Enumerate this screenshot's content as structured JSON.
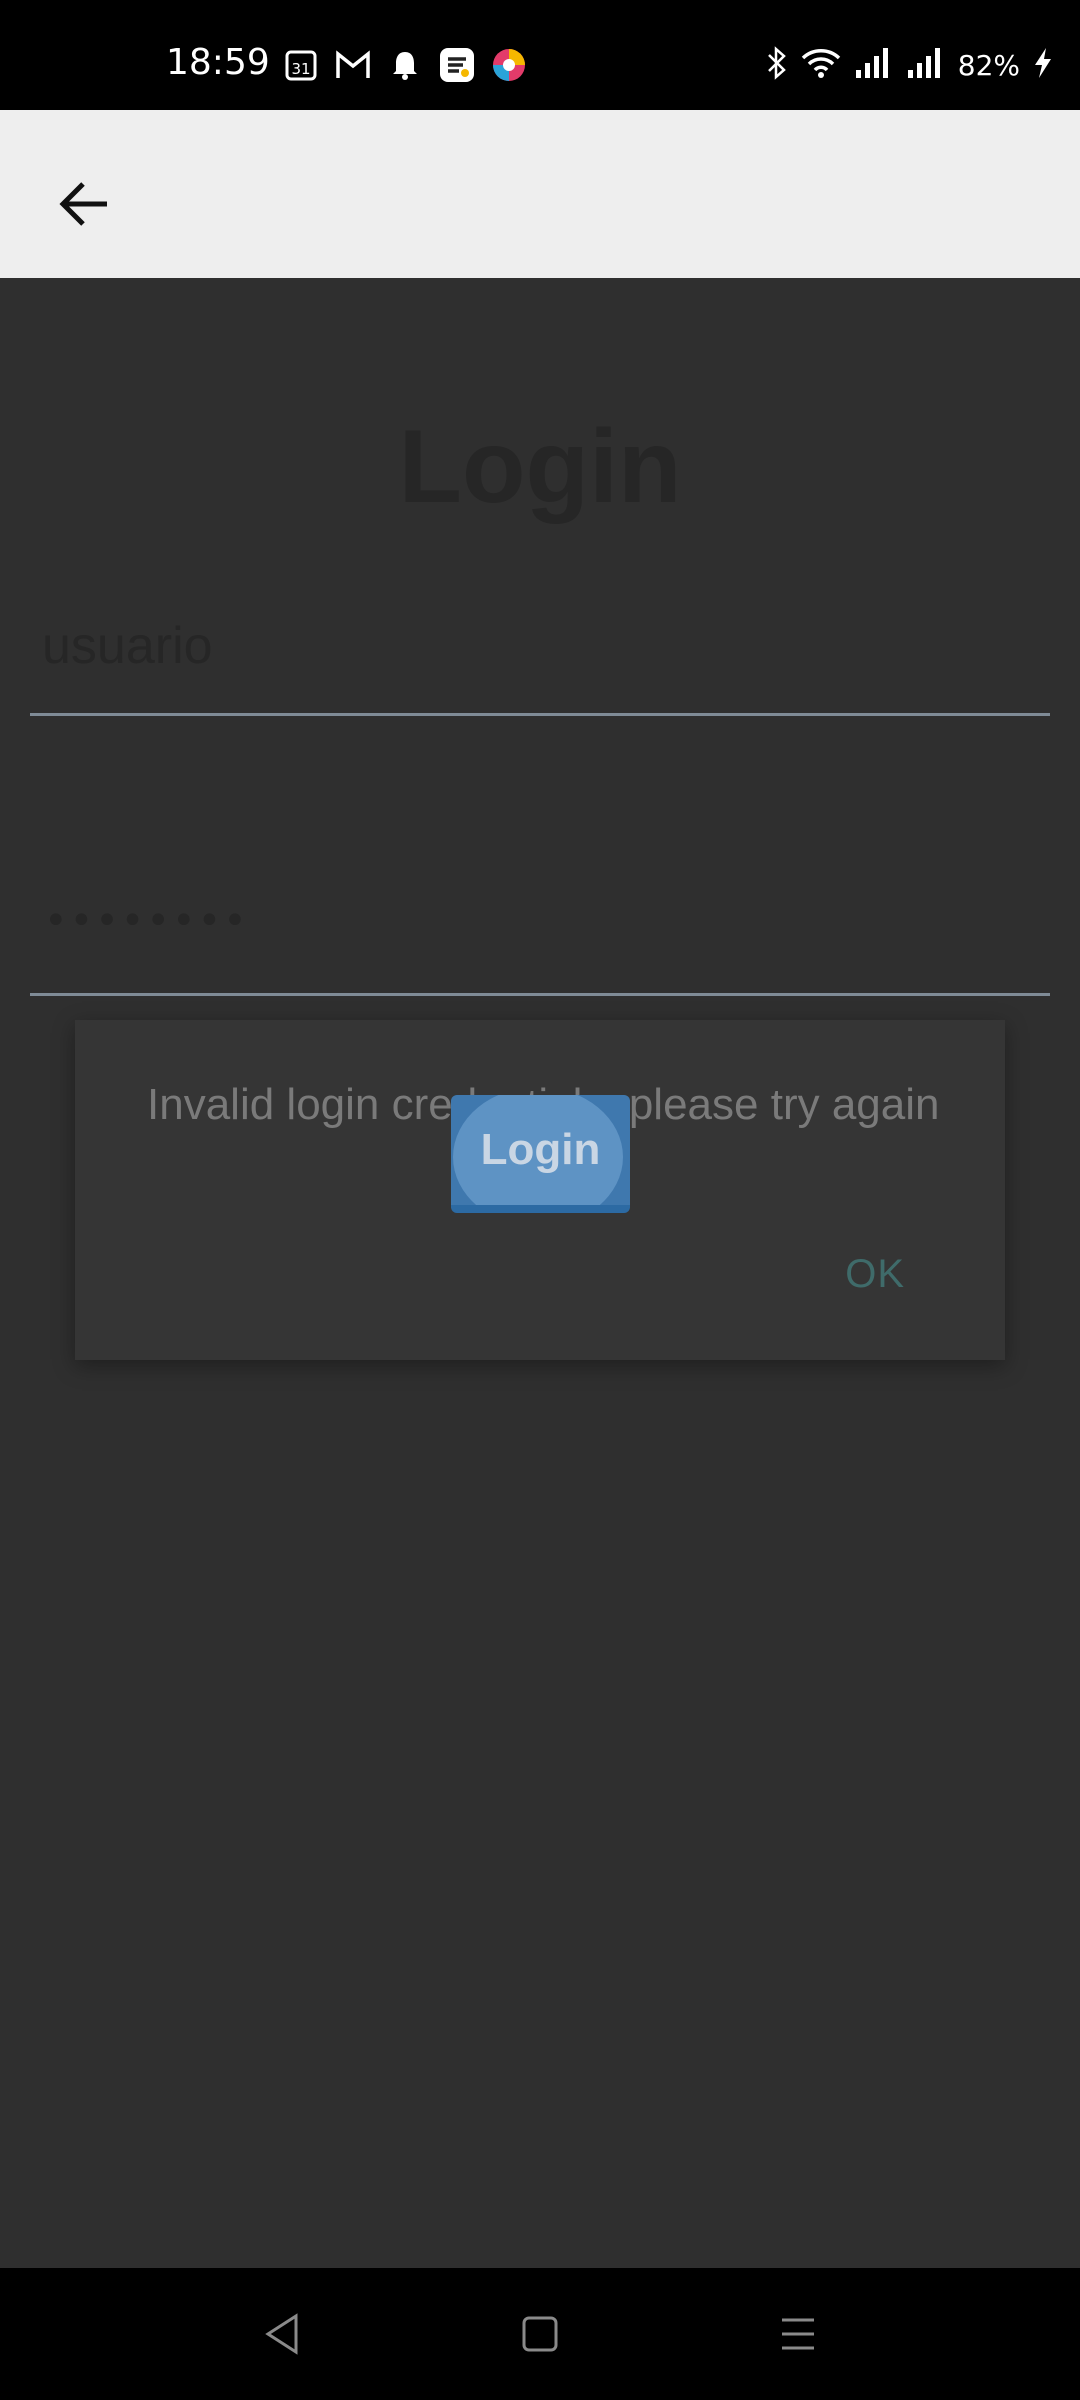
{
  "status_bar": {
    "time": "18:59",
    "calendar_day": "31",
    "battery_percent": "82%",
    "icons": [
      "calendar-icon",
      "gmail-icon",
      "notification-bell-icon",
      "app-icon",
      "browser-icon",
      "bluetooth-icon",
      "wifi-icon",
      "signal-icon",
      "signal-icon-2",
      "charging-icon"
    ]
  },
  "app_bar": {
    "back_icon": "arrow-left-icon"
  },
  "login": {
    "title": "Login",
    "username_placeholder": "usuario",
    "password_value": "••••••••",
    "button_label": "Login"
  },
  "dialog": {
    "message": "Invalid login credentials, please try again",
    "ok_label": "OK"
  },
  "nav_bar": {
    "icons": [
      "back-triangle-icon",
      "home-square-icon",
      "recents-menu-icon"
    ]
  },
  "colors": {
    "background": "#2f2f2f",
    "app_bar": "#eeeeee",
    "button": "#3f78ae",
    "dialog": "#353535"
  }
}
